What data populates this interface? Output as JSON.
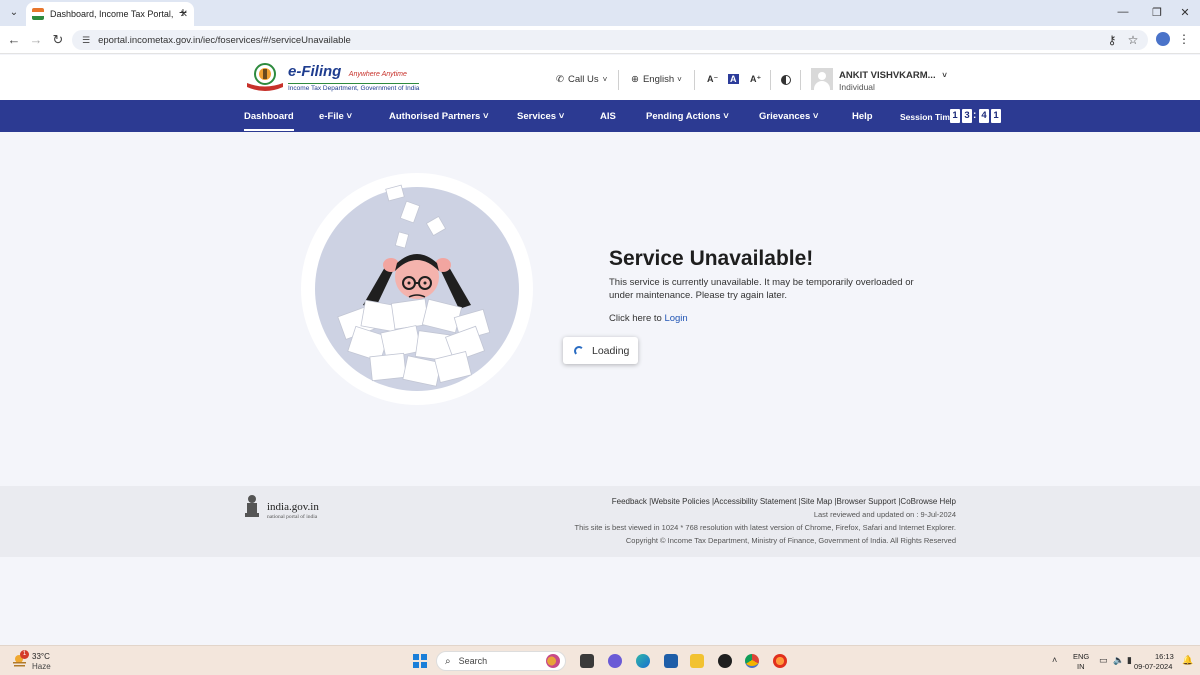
{
  "browser": {
    "tab_title": "Dashboard, Income Tax Portal, G",
    "url": "eportal.incometax.gov.in/iec/foservices/#/serviceUnavailable"
  },
  "header": {
    "logo_title": "e-Filing",
    "logo_tagline": "Anywhere Anytime",
    "logo_dept": "Income Tax Department, Government of India",
    "call_us": "Call Us",
    "language": "English",
    "font_decrease": "A⁻",
    "font_reset": "A",
    "font_increase": "A⁺",
    "user_name": "ANKIT VISHVKARM...",
    "user_role": "Individual"
  },
  "nav": {
    "items": [
      {
        "label": "Dashboard",
        "active": true
      },
      {
        "label": "e-File ˅"
      },
      {
        "label": "Authorised Partners ˅"
      },
      {
        "label": "Services ˅"
      },
      {
        "label": "AIS"
      },
      {
        "label": "Pending Actions ˅"
      },
      {
        "label": "Grievances ˅"
      },
      {
        "label": "Help"
      }
    ],
    "session_label": "Session Time",
    "session_digits": [
      "1",
      "3",
      "4",
      "1"
    ]
  },
  "content": {
    "title": "Service Unavailable!",
    "message": "This service is currently unavailable. It may be temporarily overloaded or under maintenance. Please try again later.",
    "login_prefix": "Click here to",
    "login_link": "Login",
    "loading": "Loading"
  },
  "footer": {
    "portal_name": "india.gov.in",
    "portal_sub": "national portal of india",
    "links": [
      "Feedback",
      "Website Policies",
      "Accessibility Statement",
      "Site Map",
      "Browser Support",
      "CoBrowse Help"
    ],
    "last_reviewed": "Last reviewed and updated on : 9-Jul-2024",
    "best_viewed": "This site is best viewed in 1024 * 768 resolution with latest version of Chrome, Firefox, Safari and Internet Explorer.",
    "copyright": "Copyright © Income Tax Department, Ministry of Finance, Government of India. All Rights Reserved"
  },
  "taskbar": {
    "temperature": "33°C",
    "condition": "Haze",
    "weather_badge": "1",
    "search": "Search",
    "lang_line1": "ENG",
    "lang_line2": "IN",
    "time": "16:13",
    "date": "09-07-2024"
  },
  "colors": {
    "nav_bg": "#2c3a92",
    "link": "#2256b5",
    "spinner": "#2a6cc2"
  }
}
